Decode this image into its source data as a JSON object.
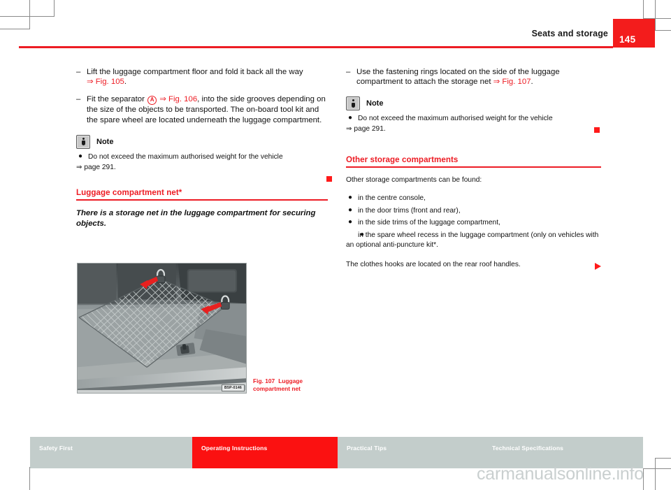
{
  "header": {
    "title": "Seats and storage",
    "page_number": "145",
    "accent_color": "#ed1c24",
    "page_block_color": "#f31c1c"
  },
  "left_column": {
    "steps": [
      {
        "marker": "–",
        "text_before": "Lift the luggage compartment floor and fold it back all the way ",
        "ref": "⇒ Fig. 105",
        "text_after": "."
      },
      {
        "marker": "–",
        "text_before": "Fit the separator ",
        "callout": "A",
        "ref": "⇒ Fig. 106",
        "text_after": ", into the side grooves depending on the size of the objects to be transported. The on-board tool kit and the spare wheel are located underneath the luggage compartment."
      }
    ],
    "note": {
      "icon": "info-icon",
      "label": "Note",
      "bullet": "●",
      "text": "Do not exceed the maximum authorised weight for the vehicle",
      "ref": "⇒ page 291."
    },
    "section": {
      "title": "Luggage compartment net*",
      "lead": "There is a storage net in the luggage compartment for securing objects."
    },
    "figure": {
      "code_label": "B5P-0146",
      "caption_number": "Fig. 107",
      "caption_text": "Luggage compartment net",
      "alt": "Luggage compartment with storage net attached to fastening rings"
    }
  },
  "right_column": {
    "steps": [
      {
        "marker": "–",
        "text_before": "Use the fastening rings located on the side of the luggage compartment to attach the storage net ",
        "ref": "⇒ Fig. 107",
        "text_after": "."
      }
    ],
    "note": {
      "icon": "info-icon",
      "label": "Note",
      "bullet": "●",
      "text": "Do not exceed the maximum authorised weight for the vehicle",
      "ref": "⇒ page 291."
    },
    "section": {
      "title": "Other storage compartments",
      "intro": "Other storage compartments can be found:",
      "bullets": [
        "in the centre console,",
        "in the door trims (front and rear),",
        "in the side trims of the luggage compartment,",
        "in the spare wheel recess in the luggage compartment (only on vehicles with an optional anti-puncture kit*."
      ],
      "closing": "The clothes hooks are located on the rear roof handles."
    }
  },
  "footer": {
    "tabs": [
      {
        "label": "Safety First",
        "active": false
      },
      {
        "label": "Operating Instructions",
        "active": true
      },
      {
        "label": "Practical Tips",
        "active": false
      },
      {
        "label": "Technical Specifications",
        "active": false
      }
    ],
    "active_color": "#fb1111",
    "inactive_color": "#c3cdcb"
  },
  "watermark": {
    "text": "carmanualsonline.info"
  }
}
